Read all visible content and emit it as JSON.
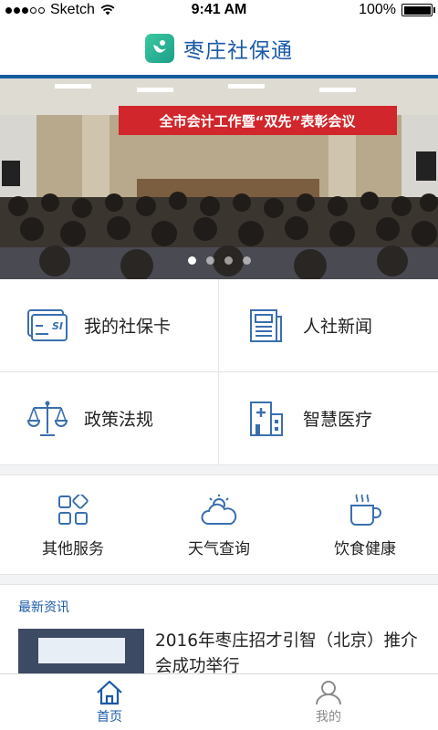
{
  "status_bar": {
    "carrier": "Sketch",
    "time": "9:41 AM",
    "battery": "100%"
  },
  "header": {
    "title": "枣庄社保通",
    "logo_icon": "app-logo-icon"
  },
  "banner": {
    "caption": "全市会计工作暨“双先”表彰会议",
    "pages": 4,
    "active_page": 1
  },
  "main_grid": [
    {
      "label": "我的社保卡",
      "icon": "social-security-card-icon"
    },
    {
      "label": "人社新闻",
      "icon": "newspaper-icon"
    },
    {
      "label": "政策法规",
      "icon": "scales-icon"
    },
    {
      "label": "智慧医疗",
      "icon": "hospital-icon"
    }
  ],
  "sub_services": [
    {
      "label": "其他服务",
      "icon": "grid-apps-icon"
    },
    {
      "label": "天气查询",
      "icon": "weather-icon"
    },
    {
      "label": "饮食健康",
      "icon": "hot-drink-icon"
    }
  ],
  "news": {
    "section_title": "最新资讯",
    "items": [
      {
        "title": "2016年枣庄招才引智（北京）推介会成功举行"
      }
    ]
  },
  "tab_bar": {
    "tabs": [
      {
        "label": "首页",
        "icon": "home-icon",
        "active": true
      },
      {
        "label": "我的",
        "icon": "user-icon",
        "active": false
      }
    ]
  },
  "colors": {
    "brand_blue": "#1a5aa8",
    "header_rule": "#155b9e",
    "icon_blue": "#3a6fae",
    "background": "#f2f3f5"
  }
}
